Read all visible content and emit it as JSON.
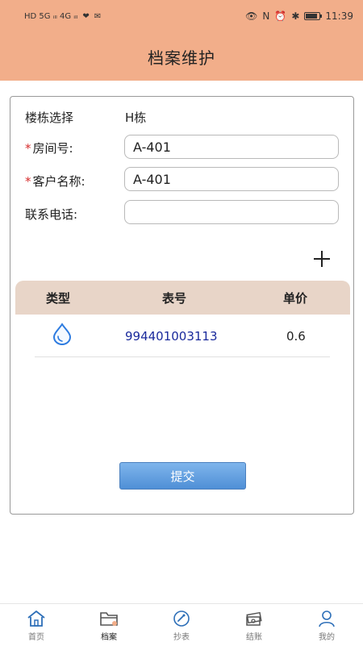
{
  "status_bar": {
    "left_text": "HD 5G ᵢₗₗ 4G ᵢₗₗ",
    "time": "11:39"
  },
  "header": {
    "title": "档案维护"
  },
  "form": {
    "building_label": "楼栋选择",
    "building_value": "H栋",
    "room_required_mark": "*",
    "room_label": "房间号:",
    "room_value": "A-401",
    "customer_required_mark": "*",
    "customer_label": "客户名称:",
    "customer_value": "A-401",
    "phone_label": "联系电话:",
    "phone_value": ""
  },
  "table": {
    "headers": [
      "类型",
      "表号",
      "单价"
    ],
    "rows": [
      {
        "type_icon": "water-drop-icon",
        "meter_no": "994401003113",
        "price": "0.6"
      }
    ]
  },
  "submit_label": "提交",
  "nav": {
    "items": [
      {
        "label": "首页",
        "icon": "home-icon"
      },
      {
        "label": "档案",
        "icon": "folder-icon",
        "active": true
      },
      {
        "label": "抄表",
        "icon": "meter-reading-icon"
      },
      {
        "label": "结账",
        "icon": "money-icon"
      },
      {
        "label": "我的",
        "icon": "user-icon"
      }
    ]
  },
  "colors": {
    "header_bg": "#F2AE8A",
    "table_header_bg": "#E8D5C8",
    "accent_blue": "#4F8FD6",
    "meter_no_color": "#1A2A9C",
    "required_color": "#D62C2C"
  }
}
